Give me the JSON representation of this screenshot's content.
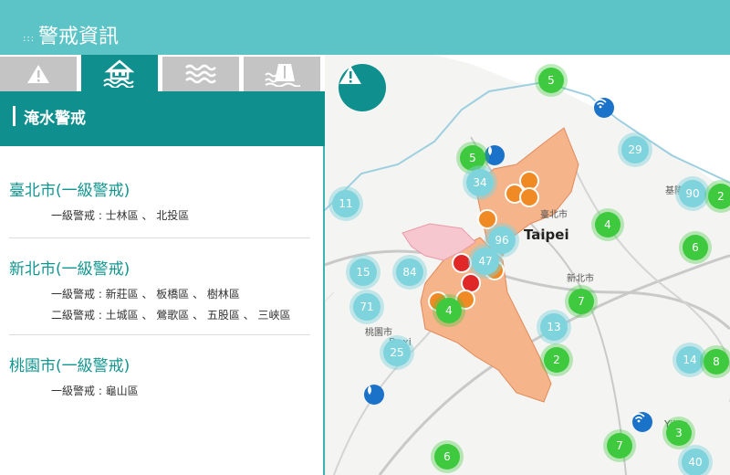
{
  "header": {
    "title": "警戒資訊"
  },
  "tabs": [
    {
      "icon": "warning-icon"
    },
    {
      "icon": "flooded-house-icon",
      "active": true
    },
    {
      "icon": "waves-icon"
    },
    {
      "icon": "dam-icon"
    }
  ],
  "section": {
    "title": "淹水警戒"
  },
  "regions": [
    {
      "name": "臺北市(一級警戒)",
      "lines": [
        "一級警戒 : 士林區 、 北投區"
      ]
    },
    {
      "name": "新北市(一級警戒)",
      "lines": [
        "一級警戒 : 新莊區 、 板橋區 、 樹林區",
        "二級警戒 : 土城區 、 鶯歌區 、 五股區 、 三峽區"
      ]
    },
    {
      "name": "桃園市(一級警戒)",
      "lines": [
        "一級警戒 : 龜山區"
      ]
    }
  ],
  "map": {
    "labels": {
      "taipei": "Taipei",
      "taipei_city": "臺北市",
      "keelung": "基隆市",
      "newtaipei": "新北市",
      "taoyuan": "桃園市",
      "daxi": "Daxi",
      "yilan": "Yilan"
    },
    "clusters": [
      {
        "label": "5",
        "color": "green"
      },
      {
        "label": "29",
        "color": "teal"
      },
      {
        "label": "5",
        "color": "green"
      },
      {
        "label": "34",
        "color": "teal"
      },
      {
        "label": "11",
        "color": "teal"
      },
      {
        "label": "90",
        "color": "teal"
      },
      {
        "label": "2",
        "color": "green"
      },
      {
        "label": "4",
        "color": "green"
      },
      {
        "label": "96",
        "color": "teal"
      },
      {
        "label": "6",
        "color": "green"
      },
      {
        "label": "15",
        "color": "teal"
      },
      {
        "label": "84",
        "color": "teal"
      },
      {
        "label": "47",
        "color": "teal"
      },
      {
        "label": "71",
        "color": "teal"
      },
      {
        "label": "4",
        "color": "green"
      },
      {
        "label": "7",
        "color": "green"
      },
      {
        "label": "13",
        "color": "teal"
      },
      {
        "label": "25",
        "color": "teal"
      },
      {
        "label": "2",
        "color": "green"
      },
      {
        "label": "14",
        "color": "teal"
      },
      {
        "label": "8",
        "color": "green"
      },
      {
        "label": "3",
        "color": "green"
      },
      {
        "label": "7",
        "color": "green"
      },
      {
        "label": "6",
        "color": "green"
      },
      {
        "label": "40",
        "color": "teal"
      }
    ]
  },
  "colors": {
    "header": "#5cc4c6",
    "accent": "#0f8f8e",
    "region_text": "#12958f",
    "orange_zone": "#f6b48a",
    "pink_zone": "#f7c7cf"
  }
}
